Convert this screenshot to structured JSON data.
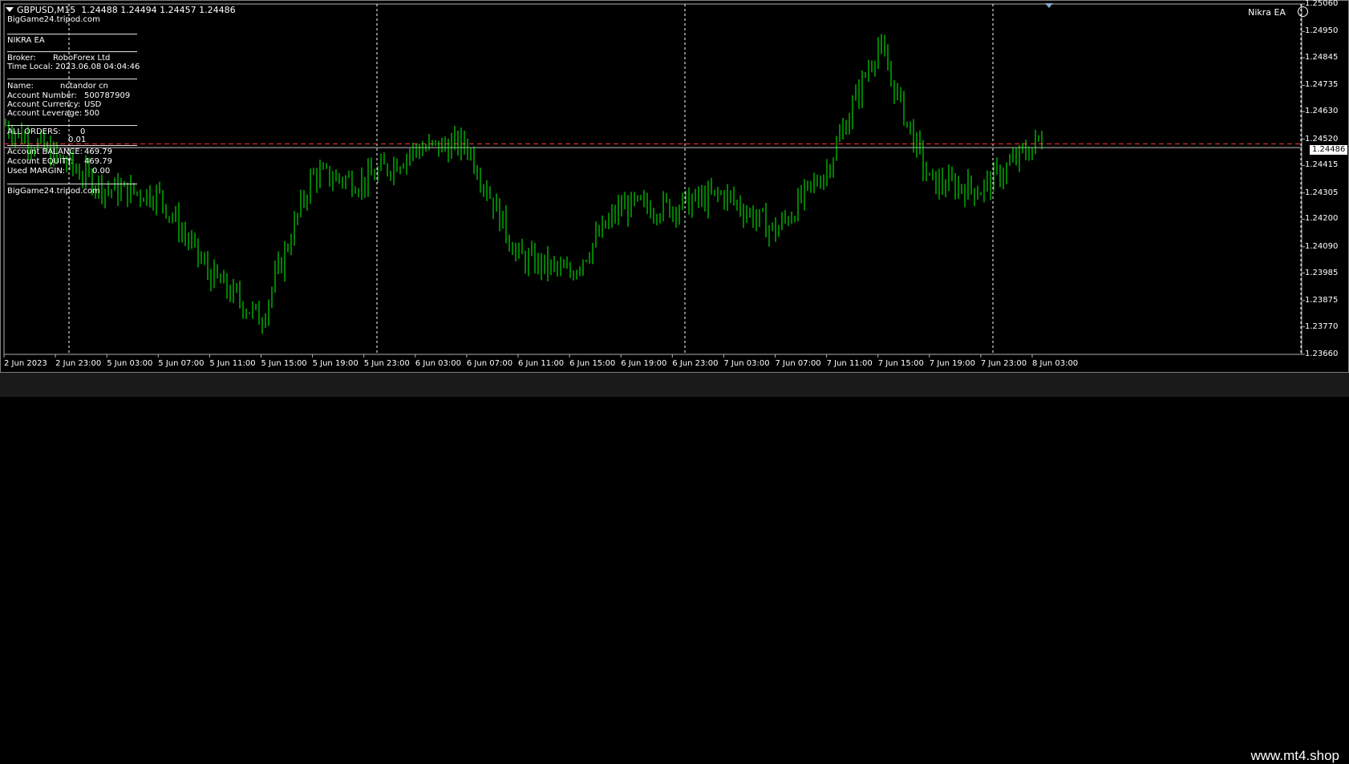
{
  "header": {
    "symbol_tf": "GBPUSD,M15",
    "ohlc": "1.24488 1.24494 1.24457 1.24486",
    "site": "BigGame24.tripod.com"
  },
  "ea_label": "Nikra EA",
  "info_panel": {
    "ea_title": "NIKRA EA",
    "broker_label": "Broker:",
    "broker_value": "RoboForex Ltd",
    "time_label": "Time Local:",
    "time_value": "2023.06.08 04:04:46",
    "name_label": "Name:",
    "name_value": "nctandor cn",
    "acct_num_label": "Account Number:",
    "acct_num_value": "500787909",
    "acct_cur_label": "Account Currency:",
    "acct_cur_value": "USD",
    "acct_lev_label": "Account Leverage:",
    "acct_lev_value": "500",
    "all_orders_label": "ALL ORDERS:",
    "all_orders_value": "0",
    "lot_value": "0.01",
    "balance_label": "Account BALANCE:",
    "balance_value": "469.79",
    "equity_label": "Account EQUITY:",
    "equity_value": "469.79",
    "margin_label": "Used MARGIN:",
    "margin_value": "0.00",
    "footer_site": "BigGame24.tripod.com"
  },
  "price_axis": [
    "1.25060",
    "1.24950",
    "1.24845",
    "1.24735",
    "1.24630",
    "1.24520",
    "1.24415",
    "1.24305",
    "1.24200",
    "1.24090",
    "1.23985",
    "1.23875",
    "1.23770",
    "1.23660"
  ],
  "current_price": "1.24486",
  "time_axis": [
    "2 Jun 2023",
    "2 Jun 23:00",
    "5 Jun 03:00",
    "5 Jun 07:00",
    "5 Jun 11:00",
    "5 Jun 15:00",
    "5 Jun 19:00",
    "5 Jun 23:00",
    "6 Jun 03:00",
    "6 Jun 07:00",
    "6 Jun 11:00",
    "6 Jun 15:00",
    "6 Jun 19:00",
    "6 Jun 23:00",
    "7 Jun 03:00",
    "7 Jun 07:00",
    "7 Jun 11:00",
    "7 Jun 15:00",
    "7 Jun 19:00",
    "7 Jun 23:00",
    "8 Jun 03:00"
  ],
  "watermark": "www.mt4.shop",
  "colors": {
    "candles": "#00ff00",
    "grid": "#ffffff",
    "bid_line": "#c0c0c0",
    "ask_line": "#ff3333"
  },
  "chart_data": {
    "type": "line",
    "symbol": "GBPUSD",
    "timeframe": "M15",
    "ylim": [
      1.2366,
      1.2506
    ],
    "series": [
      {
        "x": [
          "2 Jun 2023",
          "2 Jun 23:00",
          "5 Jun 03:00",
          "5 Jun 07:00",
          "5 Jun 11:00",
          "5 Jun 15:00",
          "5 Jun 19:00",
          "5 Jun 23:00",
          "6 Jun 03:00",
          "6 Jun 07:00",
          "6 Jun 11:00",
          "6 Jun 15:00",
          "6 Jun 19:00",
          "6 Jun 23:00",
          "7 Jun 03:00",
          "7 Jun 07:00",
          "7 Jun 11:00",
          "7 Jun 15:00",
          "7 Jun 19:00",
          "7 Jun 23:00",
          "8 Jun 03:00"
        ],
        "values": [
          1.2458,
          1.2445,
          1.2432,
          1.243,
          1.2398,
          1.238,
          1.2438,
          1.2435,
          1.2448,
          1.245,
          1.2405,
          1.2398,
          1.2425,
          1.2425,
          1.243,
          1.2415,
          1.244,
          1.249,
          1.2435,
          1.2432,
          1.2449
        ]
      }
    ]
  }
}
